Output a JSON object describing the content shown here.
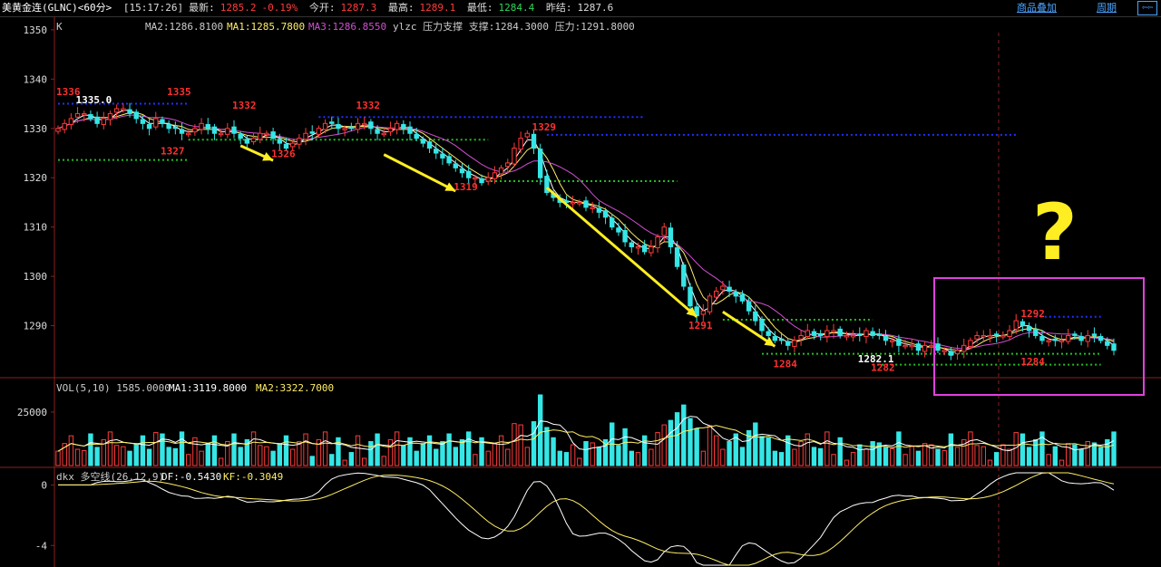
{
  "header": {
    "title": "美黄金连(GLNC)<60分>",
    "time": "[15:17:26]",
    "latest_label": "最新:",
    "latest_value": "1285.2",
    "change": "-0.19%",
    "open_label": "今开:",
    "open_value": "1287.3",
    "high_label": "最高:",
    "high_value": "1289.1",
    "low_label": "最低:",
    "low_value": "1284.4",
    "prev_close_label": "昨结:",
    "prev_close_value": "1287.6",
    "link_add": "商品叠加",
    "link_period": "周期",
    "btn_back": "⇦⇦"
  },
  "price_panel": {
    "label_k": "K",
    "ma2": "MA2:1286.8100",
    "ma1": "MA1:1285.7800",
    "ma3": "MA3:1286.8550",
    "ylzc": "ylzc 压力支撑 支撑:1284.3000 压力:1291.8000",
    "question_mark": "?"
  },
  "volume_panel": {
    "title": "VOL(5,10) 1585.0000",
    "ma1": "MA1:3119.8000",
    "ma2": "MA2:3322.7000"
  },
  "indicator_panel": {
    "title": "dkx 多空线(26,12,9)",
    "df": "DF:-0.5430",
    "kf": "KF:-0.3049"
  },
  "chart_data": [
    {
      "type": "candlestick",
      "ylim": [
        1280,
        1352
      ],
      "yticks": [
        1290,
        1300,
        1310,
        1320,
        1330,
        1340,
        1350
      ],
      "close": [
        1330,
        1331,
        1332,
        1333,
        1333,
        1332,
        1331,
        1332,
        1333,
        1334,
        1334,
        1333,
        1332,
        1331,
        1330,
        1332,
        1331,
        1330,
        1330,
        1329,
        1329,
        1330,
        1331,
        1330,
        1329,
        1329,
        1330,
        1329,
        1328,
        1327,
        1328,
        1329,
        1329,
        1328,
        1327,
        1326,
        1327,
        1328,
        1329,
        1329,
        1330,
        1331,
        1331,
        1330,
        1330,
        1330,
        1331,
        1331,
        1330,
        1329,
        1329,
        1330,
        1331,
        1330,
        1329,
        1328,
        1327,
        1326,
        1325,
        1324,
        1323,
        1322,
        1321,
        1320,
        1320,
        1319,
        1320,
        1321,
        1322,
        1323,
        1326,
        1328,
        1329,
        1326,
        1320,
        1317,
        1316,
        1315,
        1315,
        1315,
        1315,
        1314,
        1314,
        1313,
        1312,
        1310,
        1309,
        1307,
        1306,
        1306,
        1305,
        1306,
        1308,
        1310,
        1306,
        1302,
        1298,
        1294,
        1292,
        1293,
        1296,
        1297,
        1298,
        1297,
        1296,
        1295,
        1293,
        1291,
        1289,
        1288,
        1287,
        1287,
        1286,
        1287,
        1288,
        1289,
        1288,
        1288,
        1289,
        1289,
        1288,
        1288,
        1288,
        1288,
        1289,
        1288,
        1288,
        1287,
        1287,
        1286,
        1286,
        1286,
        1285,
        1286,
        1286,
        1285,
        1285,
        1284,
        1285,
        1286,
        1287,
        1288,
        1288,
        1288,
        1288,
        1288,
        1289,
        1291,
        1290,
        1289,
        1288,
        1287,
        1287,
        1287,
        1287,
        1288,
        1288,
        1287,
        1288,
        1288,
        1287,
        1286,
        1285
      ],
      "support_level": 1284.3,
      "resistance_level": 1291.8,
      "annotations": [
        {
          "text": "1336",
          "color": "red"
        },
        {
          "text": "1335.0",
          "color": "white"
        },
        {
          "text": "1335",
          "color": "red"
        },
        {
          "text": "1327",
          "color": "red"
        },
        {
          "text": "1332",
          "color": "red"
        },
        {
          "text": "1326",
          "color": "red"
        },
        {
          "text": "1332",
          "color": "red"
        },
        {
          "text": "1319",
          "color": "red"
        },
        {
          "text": "1329",
          "color": "red"
        },
        {
          "text": "1291",
          "color": "red"
        },
        {
          "text": "1284",
          "color": "red"
        },
        {
          "text": "1282.1",
          "color": "white"
        },
        {
          "text": "1282",
          "color": "red"
        },
        {
          "text": "1292",
          "color": "red"
        },
        {
          "text": "1284",
          "color": "red"
        }
      ]
    },
    {
      "type": "bar",
      "title": "VOL(5,10)",
      "yticks": [
        25000
      ],
      "ylim": [
        0,
        33000
      ]
    },
    {
      "type": "line",
      "title": "dkx 多空线(26,12,9)",
      "yticks": [
        0,
        -4
      ],
      "ylim": [
        -5.3,
        0.8
      ]
    }
  ]
}
